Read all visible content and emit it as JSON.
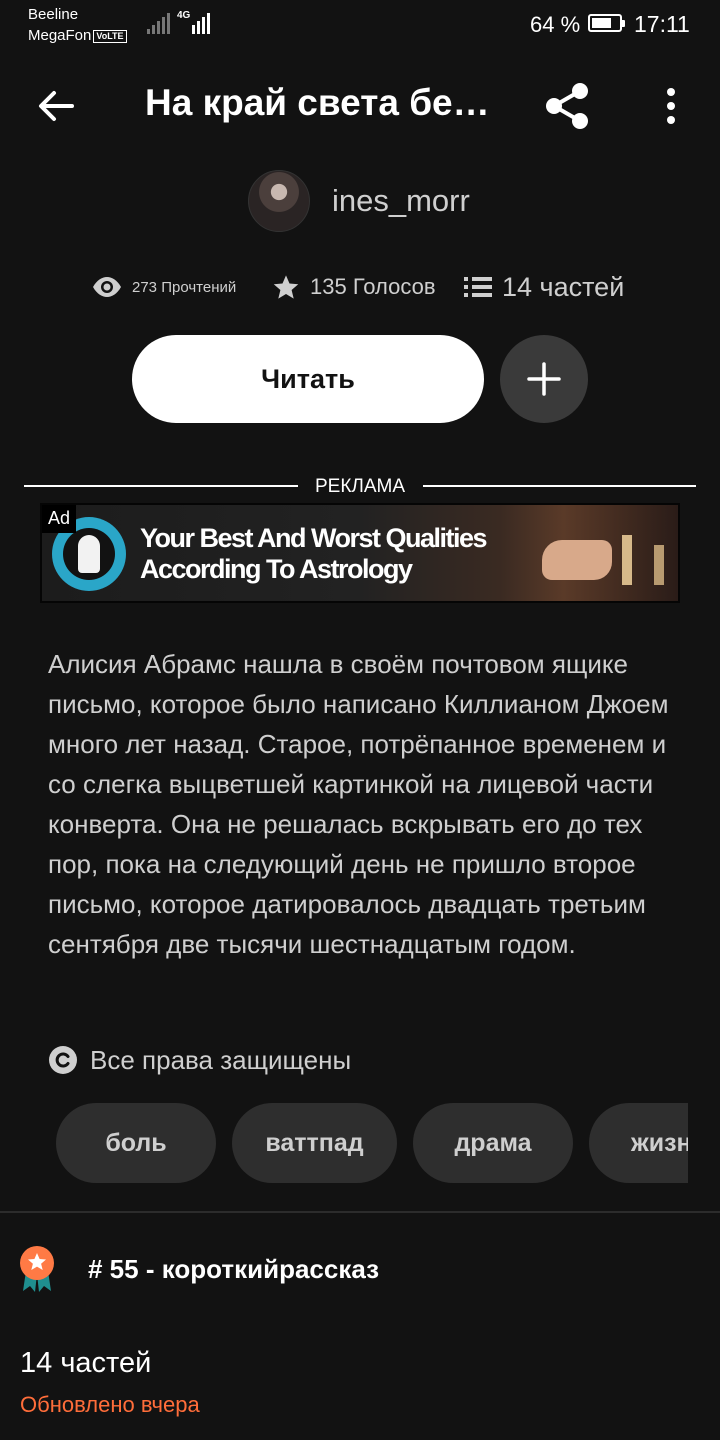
{
  "status_bar": {
    "carrier_1": "Beeline",
    "carrier_2": "MegaFon",
    "volte_badge": "VoLTE",
    "network": "4G",
    "battery_percent": "64 %",
    "battery_level": 0.64,
    "time": "17:11"
  },
  "header": {
    "title": "На край света бе…",
    "back_icon": "arrow-left-icon",
    "share_icon": "share-icon",
    "menu_icon": "more-vertical-icon"
  },
  "author": {
    "name": "ines_morr"
  },
  "stats": {
    "reads": "273 Прочтений",
    "votes": "135 Голосов",
    "parts": "14 частей"
  },
  "actions": {
    "read_label": "Читать",
    "add_icon": "plus-icon"
  },
  "ad": {
    "section_label": "РЕКЛАМА",
    "badge": "Ad",
    "headline": "Your Best And Worst Qualities According To Astrology"
  },
  "description": "Алисия Абрамс нашла в своём почтовом ящике письмо, которое было написано Киллианом Джоем много лет назад. Старое, потрёпанное временем и со слегка выцветшей картинкой на лицевой части конверта. Она не решалась вскрывать его до тех пор, пока на следующий день не пришло второе письмо, которое датировалось двадцать третьим сентября две тысячи шестнадцатым годом.",
  "copyright": "Все права защищены",
  "tags": [
    "боль",
    "ваттпад",
    "драма",
    "жизнь"
  ],
  "ranking": "# 55 - короткийрассказ",
  "parts_section": {
    "title": "14 частей",
    "updated": "Обновлено вчера"
  },
  "colors": {
    "background": "#121212",
    "accent": "#ff6d3a",
    "badge_orange": "#ff7a45",
    "badge_teal": "#1f8f8f"
  }
}
